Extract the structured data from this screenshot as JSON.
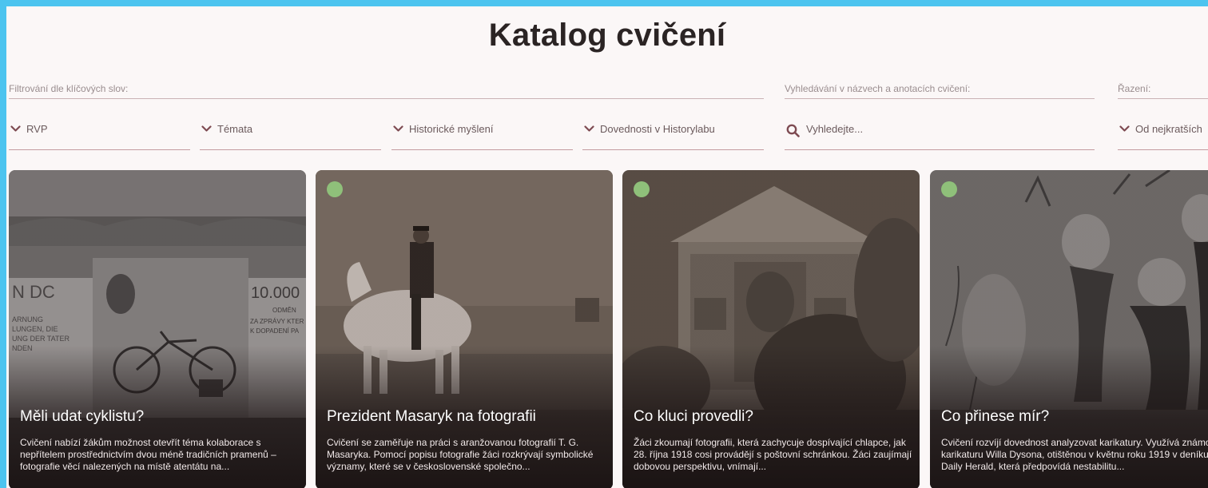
{
  "page_title": "Katalog cvičení",
  "filters": {
    "keywords_label": "Filtrování dle klíčových slov:",
    "search_label": "Vyhledávání v názvech a anotacích cvičení:",
    "sort_label": "Řazení:",
    "dropdowns": [
      {
        "label": "RVP"
      },
      {
        "label": "Témata"
      },
      {
        "label": "Historické myšlení"
      },
      {
        "label": "Dovednosti v Historylabu"
      }
    ],
    "search_placeholder": "Vyhledejte...",
    "sort_value": "Od nejkratších"
  },
  "cards": [
    {
      "title": "Měli udat cyklistu?",
      "description": "Cvičení nabízí žákům možnost otevřít téma kolaborace s nepřítelem prostřednictvím dvou méně tradičních pramenů – fotografie věcí nalezených na místě atentátu na...",
      "has_dot": false,
      "sign_left": "N DC\nARNUNG\nLUNGEN, DIE\nUNG DER TATER\nNDEN",
      "sign_right": "10.000\nODMĚN\nZA ZPRÁVY KTER\nK DOPADENÍ PA"
    },
    {
      "title": "Prezident Masaryk na fotografii",
      "description": "Cvičení se zaměřuje na práci s aranžovanou fotografií T. G. Masaryka. Pomocí popisu fotografie žáci rozkrývají symbolické významy, které se v československé společno...",
      "has_dot": true
    },
    {
      "title": "Co kluci provedli?",
      "description": "Žáci zkoumají fotografii, která zachycuje dospívající chlapce, jak 28. října 1918 cosi provádějí s poštovní schránkou. Žáci zaujímají dobovou perspektivu, vnímají...",
      "has_dot": true
    },
    {
      "title": "Co přinese mír?",
      "description": "Cvičení rozvíjí dovednost analyzovat karikatury. Využívá známou karikaturu Willa Dysona, otištěnou v květnu roku 1919 v deníku Daily Herald, která předpovídá nestabilitu...",
      "has_dot": true
    }
  ],
  "colors": {
    "page_background": "#fbf7f7",
    "frame": "#4cc4ef",
    "title": "#2b2424",
    "underline": "#c49b9f",
    "status_dot": "#8fc07a"
  },
  "icons": {
    "dropdown": "chevron-down-icon",
    "search": "search-icon"
  }
}
